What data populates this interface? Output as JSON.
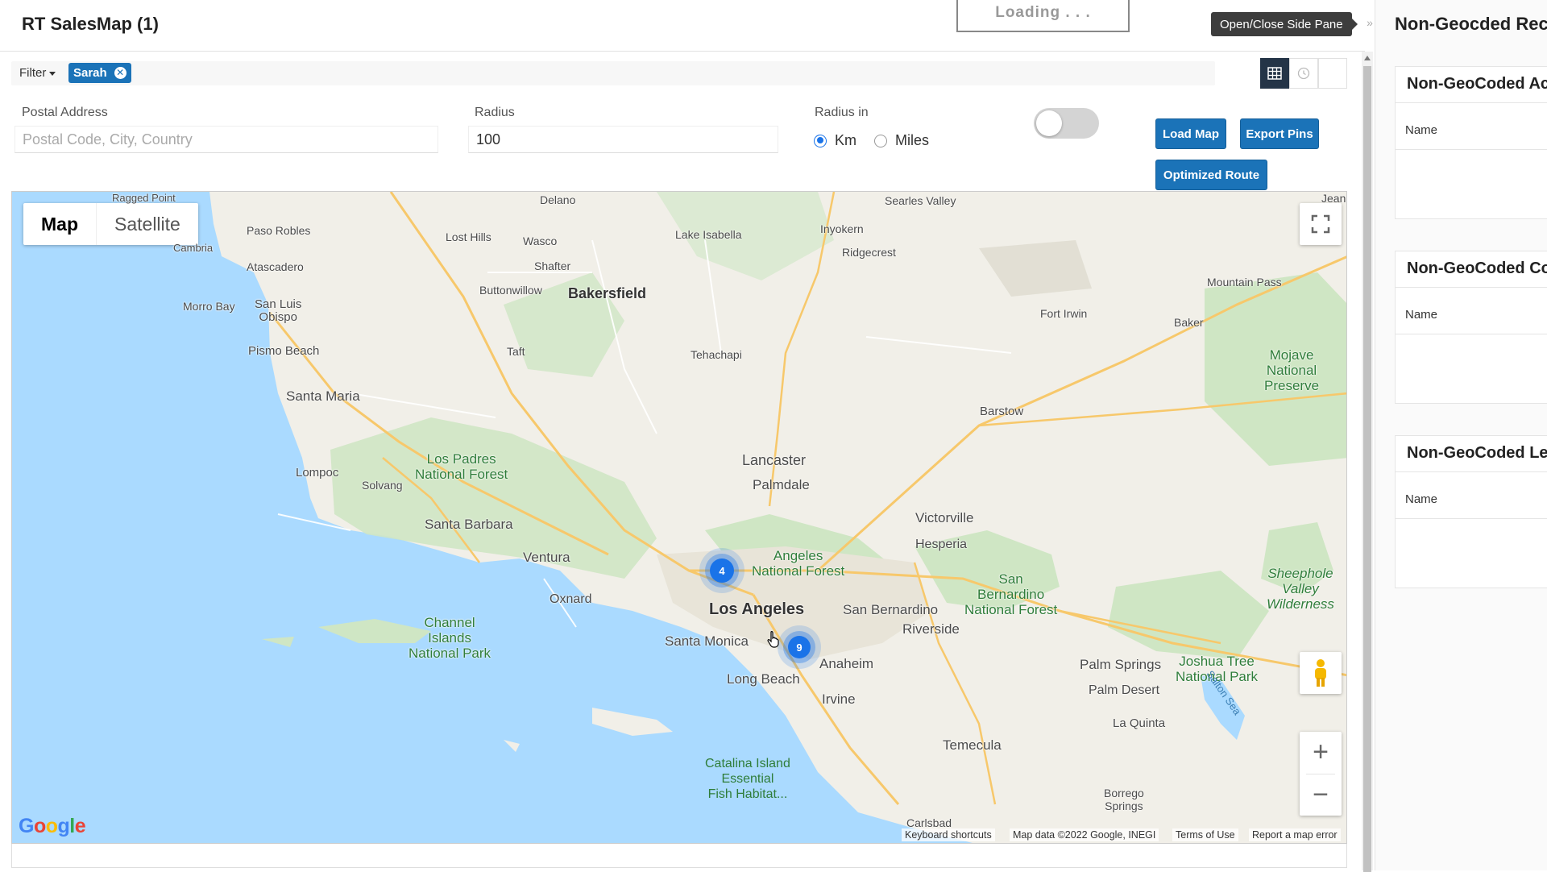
{
  "header": {
    "title": "RT SalesMap (1)",
    "loading": "Loading . . .",
    "tooltip": "Open/Close Side Pane",
    "pane_toggle": "»"
  },
  "filter": {
    "label": "Filter",
    "chip": "Sarah",
    "chip_remove": "✕"
  },
  "view_buttons": [
    "grid-icon",
    "clock-icon",
    "blank"
  ],
  "form": {
    "postal_label": "Postal Address",
    "postal_placeholder": "Postal Code, City, Country",
    "postal_value": "",
    "radius_label": "Radius",
    "radius_value": "100",
    "radius_in_label": "Radius in",
    "unit_km": "Km",
    "unit_miles": "Miles",
    "selected_unit": "Km",
    "toggle_on": false
  },
  "buttons": {
    "load_map": "Load Map",
    "export_pins": "Export Pins",
    "optimized_route": "Optimized Route"
  },
  "map": {
    "type_map": "Map",
    "type_satellite": "Satellite",
    "selected_type": "Map",
    "zoom_in": "+",
    "zoom_out": "−",
    "google": "Google",
    "attr_shortcuts": "Keyboard shortcuts",
    "attr_data": "Map data ©2022 Google, INEGI",
    "attr_terms": "Terms of Use",
    "attr_report": "Report a map error",
    "clusters": [
      {
        "label": "4",
        "size": 30
      },
      {
        "label": "9",
        "size": 28
      }
    ],
    "places": {
      "la": "Los Angeles",
      "bakersfield": "Bakersfield",
      "lancaster": "Lancaster",
      "palmdale": "Palmdale",
      "santa_barbara": "Santa Barbara",
      "ventura": "Ventura",
      "oxnard": "Oxnard",
      "santa_monica": "Santa Monica",
      "long_beach": "Long Beach",
      "anaheim": "Anaheim",
      "irvine": "Irvine",
      "riverside": "Riverside",
      "san_bernardino": "San Bernardino",
      "victorville": "Victorville",
      "hesperia": "Hesperia",
      "temecula": "Temecula",
      "palm_springs": "Palm Springs",
      "palm_desert": "Palm Desert",
      "la_quinta": "La Quinta",
      "barstow": "Barstow",
      "santa_maria": "Santa Maria",
      "lompoc": "Lompoc",
      "solvang": "Solvang",
      "pismo": "Pismo Beach",
      "slo": "San Luis\nObispo",
      "morro": "Morro Bay",
      "atascadero": "Atascadero",
      "paso": "Paso Robles",
      "cambria": "Cambria",
      "ragged": "Ragged Point",
      "delano": "Delano",
      "wasco": "Wasco",
      "lost_hills": "Lost Hills",
      "shafter": "Shafter",
      "buttonwillow": "Buttonwillow",
      "taft": "Taft",
      "tehachapi": "Tehachapi",
      "lake_isabella": "Lake Isabella",
      "inyokern": "Inyokern",
      "ridgecrest": "Ridgecrest",
      "searles": "Searles Valley",
      "fort_irwin": "Fort Irwin",
      "baker": "Baker",
      "mountain_pass": "Mountain Pass",
      "jean": "Jean",
      "carlsbad": "Carlsbad",
      "borrego": "Borrego\nSprings",
      "mojave": "Mojave\nNational\nPreserve",
      "los_padres": "Los Padres\nNational Forest",
      "angeles": "Angeles\nNational Forest",
      "san_bern_nf": "San\nBernardino\nNational Forest",
      "sheephole": "Sheephole\nValley\nWilderness",
      "joshua": "Joshua Tree\nNational Park",
      "channel": "Channel\nIslands\nNational Park",
      "catalina": "Catalina Island\nEssential\nFish Habitat...",
      "salton": "Salton Sea"
    }
  },
  "side": {
    "title": "Non-Geocded Rec",
    "cards": [
      {
        "title": "Non-GeoCoded Ac",
        "col": "Name"
      },
      {
        "title": "Non-GeoCoded Co",
        "col": "Name"
      },
      {
        "title": "Non-GeoCoded Le",
        "col": "Name"
      }
    ]
  }
}
